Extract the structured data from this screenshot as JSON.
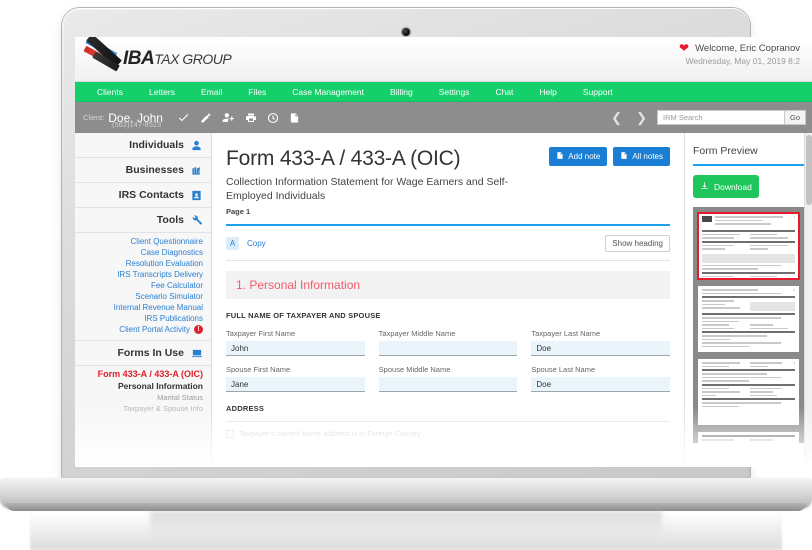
{
  "brand": {
    "name_bold": "IBA",
    "name_rest": "TAX GROUP",
    "logo_icon": "swoosh-logo"
  },
  "header": {
    "heart_icon": "heart-icon",
    "welcome": "Welcome, Eric Copranov",
    "datetime": "Wednesday, May 01, 2019 8:2"
  },
  "nav": {
    "items": [
      {
        "label": "Clients"
      },
      {
        "label": "Letters"
      },
      {
        "label": "Email"
      },
      {
        "label": "Files"
      },
      {
        "label": "Case Management"
      },
      {
        "label": "Billing"
      },
      {
        "label": "Settings"
      },
      {
        "label": "Chat"
      },
      {
        "label": "Help"
      },
      {
        "label": "Support"
      }
    ]
  },
  "client_bar": {
    "label": "Client:",
    "name": "Doe, John",
    "phone": "(562)147-8523",
    "icons": [
      "check-icon",
      "pencil-icon",
      "add-user-icon",
      "print-icon",
      "clock-icon",
      "document-icon"
    ],
    "prev_icon": "chevron-left-icon",
    "next_icon": "chevron-right-icon",
    "search_placeholder": "IRM Search",
    "search_value": "",
    "go_label": "Go"
  },
  "sidebar": {
    "sections": [
      {
        "label": "Individuals",
        "icon": "person-icon"
      },
      {
        "label": "Businesses",
        "icon": "building-icon"
      },
      {
        "label": "IRS Contacts",
        "icon": "contact-card-icon"
      },
      {
        "label": "Tools",
        "icon": "wrench-icon"
      }
    ],
    "tools": [
      {
        "label": "Client Questionnaire",
        "badge": ""
      },
      {
        "label": "Case Diagnostics",
        "badge": ""
      },
      {
        "label": "Resolution Evaluation",
        "badge": ""
      },
      {
        "label": "IRS Transcripts Delivery",
        "badge": ""
      },
      {
        "label": "Fee Calculator",
        "badge": ""
      },
      {
        "label": "Scenario Simulator",
        "badge": ""
      },
      {
        "label": "Internal Revenue Manual",
        "badge": ""
      },
      {
        "label": "IRS Publications",
        "badge": ""
      },
      {
        "label": "Client Portal Activity",
        "badge": "!"
      }
    ],
    "forms_header": {
      "label": "Forms In Use",
      "icon": "forms-icon"
    },
    "forms": {
      "active": "Form 433-A / 433-A (OIC)",
      "sub1": "Personal Information",
      "sub2": "Marital Status",
      "sub3": "Taxpayer & Spouse Info"
    }
  },
  "main": {
    "title": "Form 433-A / 433-A (OIC)",
    "subtitle": "Collection Information Statement for Wage Earners and Self-Employed Individuals",
    "page_label": "Page 1",
    "add_note_label": "Add note",
    "all_notes_label": "All notes",
    "note_icon": "document-icon",
    "font_badge": "A",
    "copy_label": "Copy",
    "show_heading_label": "Show heading",
    "section_title": "1. Personal Information",
    "group_label": "FULL NAME OF TAXPAYER AND SPOUSE",
    "fields": [
      {
        "label": "Taxpayer First Name",
        "value": "John"
      },
      {
        "label": "Taxpayer Middle Name",
        "value": ""
      },
      {
        "label": "Taxpayer Last Name",
        "value": "Doe"
      },
      {
        "label": "Spouse First Name",
        "value": "Jane"
      },
      {
        "label": "Spouse Middle Name",
        "value": ""
      },
      {
        "label": "Spouse Last Name",
        "value": "Doe"
      }
    ],
    "address_label": "ADDRESS",
    "foreign_checkbox_label": "Taxpayer's current home address is in Foreign Country"
  },
  "preview": {
    "title": "Form Preview",
    "download_label": "Download",
    "download_icon": "download-icon",
    "pages": [
      {
        "page": "1",
        "selected": true
      },
      {
        "page": "2",
        "selected": false
      },
      {
        "page": "3",
        "selected": false
      },
      {
        "page": "4",
        "selected": false
      }
    ]
  },
  "colors": {
    "nav_green": "#15cf6a",
    "accent_blue": "#1a7fd4",
    "download_green": "#1ec65b",
    "section_red": "#f15b6e",
    "form_red": "#e0202a",
    "client_bar_grey": "#8d8d8d"
  }
}
